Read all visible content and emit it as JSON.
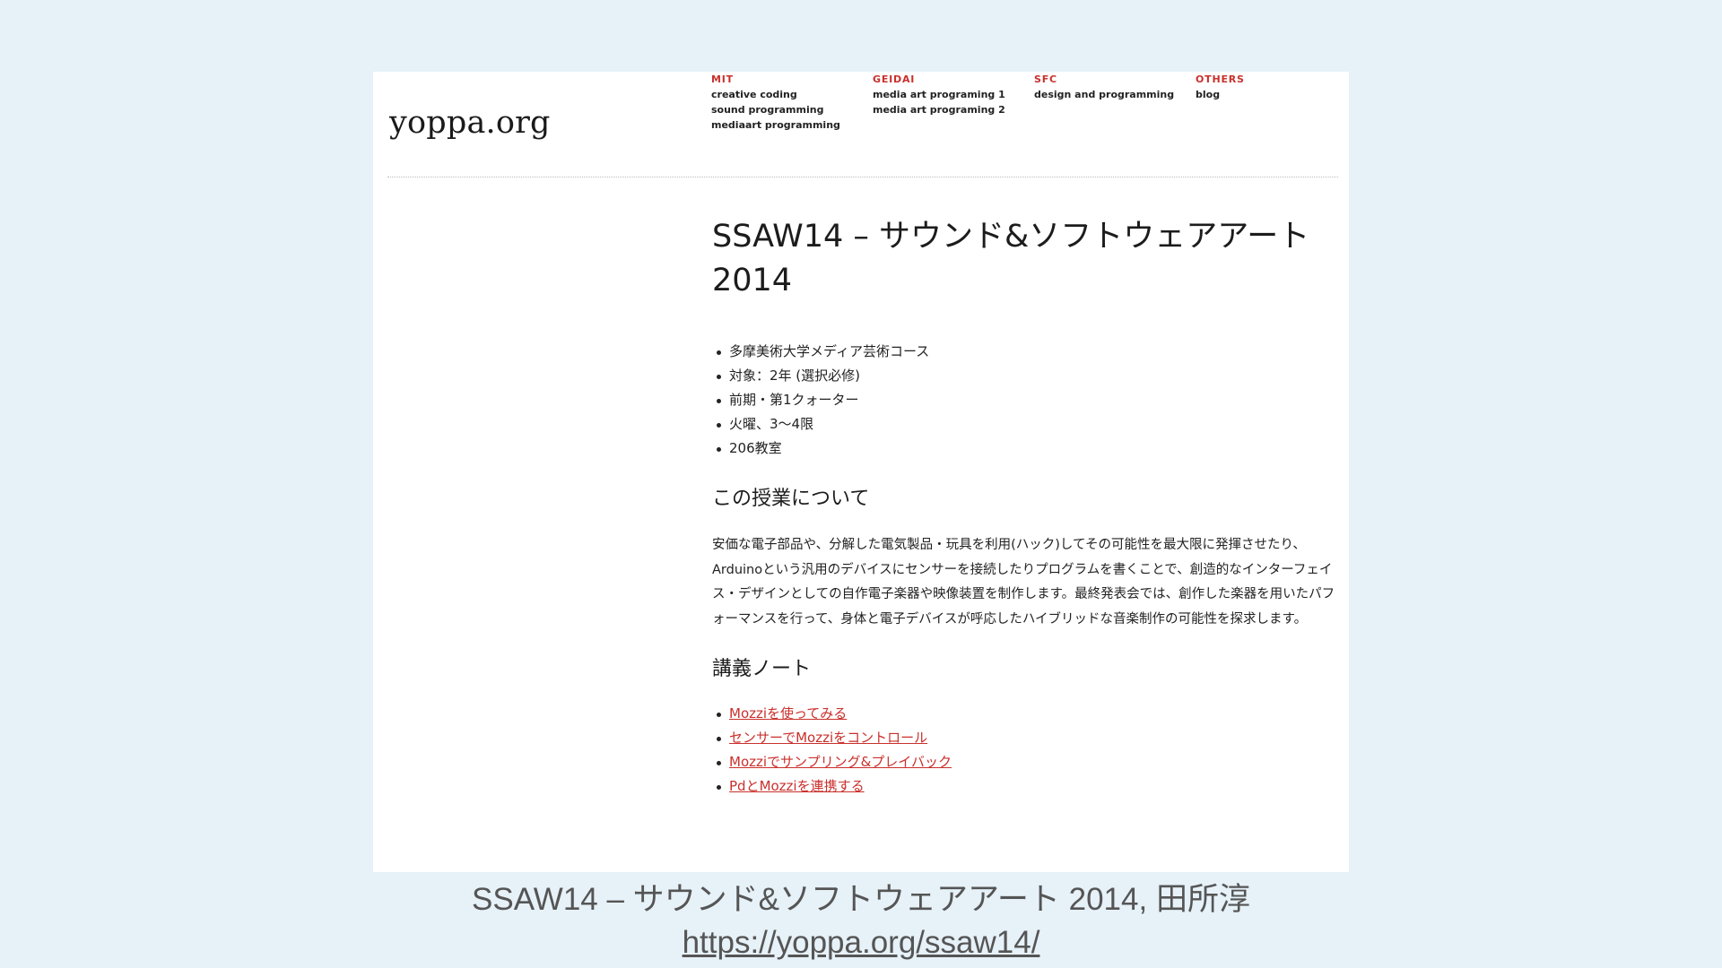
{
  "site": {
    "logo": "yoppa.org"
  },
  "nav": [
    {
      "heading": "MIT",
      "items": [
        "creative coding",
        "sound programming",
        "mediaart programming"
      ]
    },
    {
      "heading": "GEIDAI",
      "items": [
        "media art programing 1",
        "media art programing 2"
      ]
    },
    {
      "heading": "SFC",
      "items": [
        "design and programming"
      ]
    },
    {
      "heading": "OTHERS",
      "items": [
        "blog"
      ]
    }
  ],
  "article": {
    "title": "SSAW14 – サウンド&ソフトウェアアート 2014",
    "info": [
      "多摩美術大学メディア芸術コース",
      "対象：2年 (選択必修)",
      "前期・第1クォーター",
      "火曜、3〜4限",
      "206教室"
    ],
    "about_heading": "この授業について",
    "about_text": "安価な電子部品や、分解した電気製品・玩具を利用(ハック)してその可能性を最大限に発揮させたり、Arduinoという汎用のデバイスにセンサーを接続したりプログラムを書くことで、創造的なインターフェイス・デザインとしての自作電子楽器や映像装置を制作します。最終発表会では、創作した楽器を用いたパフォーマンスを行って、身体と電子デバイスが呼応したハイブリッドな音楽制作の可能性を探求します。",
    "notes_heading": "講義ノート",
    "notes": [
      "Mozziを使ってみる",
      "センサーでMozziをコントロール",
      "Mozziでサンプリング&プレイバック",
      "PdとMozziを連携する"
    ]
  },
  "caption": {
    "text": "SSAW14 – サウンド&ソフトウェアアート 2014, 田所淳",
    "url": "https://yoppa.org/ssaw14/"
  },
  "colors": {
    "background": "#e6f1f8",
    "accent": "#c9302c"
  }
}
